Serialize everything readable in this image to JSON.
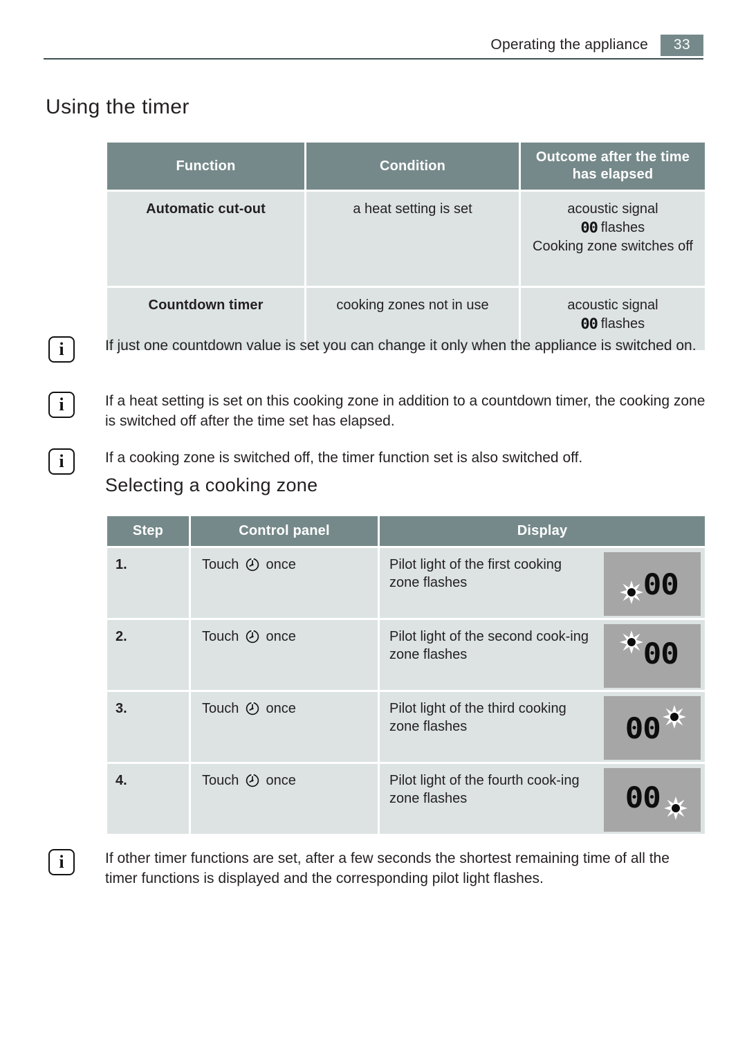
{
  "header": {
    "running_title": "Operating the appliance",
    "page_number": "33"
  },
  "headings": {
    "using_the_timer": "Using the timer",
    "selecting_a_cooking_zone": "Selecting a cooking zone"
  },
  "timer_table": {
    "columns": [
      "Function",
      "Condition",
      "Outcome after the time has elapsed"
    ],
    "rows": [
      {
        "function": "Automatic cut-out",
        "condition": "a heat setting is set",
        "outcome_line1": "acoustic signal",
        "outcome_segment": "00",
        "outcome_line2": "flashes",
        "outcome_line3": "Cooking zone switches off"
      },
      {
        "function": "Countdown timer",
        "condition": "cooking zones not in use",
        "outcome_line1": "acoustic signal",
        "outcome_segment": "00",
        "outcome_line2": "flashes",
        "outcome_line3": ""
      }
    ]
  },
  "notes": [
    {
      "icon": "info-icon",
      "text": "If just one countdown value is set you can change it only when the appliance is switched on."
    },
    {
      "icon": "info-icon",
      "text": "If a heat setting is set on this cooking zone in addition to a countdown timer, the cooking zone is switched off after the time set has elapsed."
    },
    {
      "icon": "info-icon",
      "text": "If a cooking zone is switched off, the timer function set is also switched off."
    },
    {
      "icon": "info-icon",
      "text": "If other timer functions are set, after a few seconds the shortest remaining time of all the timer functions is displayed and the corresponding pilot light flashes."
    }
  ],
  "select_zone_table": {
    "columns": [
      "Step",
      "Control panel",
      "Display"
    ],
    "rows": [
      {
        "step": "1.",
        "control_prefix": "Touch",
        "control_icon": "timer-clock-icon",
        "control_suffix": "once",
        "display_text": "Pilot light of the first cooking zone flashes",
        "lcd_value": "00",
        "lcd_dot_position": "bottom-left"
      },
      {
        "step": "2.",
        "control_prefix": "Touch",
        "control_icon": "timer-clock-icon",
        "control_suffix": "once",
        "display_text": "Pilot light of the second cook-ing zone flashes",
        "lcd_value": "00",
        "lcd_dot_position": "top-left"
      },
      {
        "step": "3.",
        "control_prefix": "Touch",
        "control_icon": "timer-clock-icon",
        "control_suffix": "once",
        "display_text": "Pilot light of the third cooking zone flashes",
        "lcd_value": "00",
        "lcd_dot_position": "top-right"
      },
      {
        "step": "4.",
        "control_prefix": "Touch",
        "control_icon": "timer-clock-icon",
        "control_suffix": "once",
        "display_text": "Pilot light of the fourth cook-ing zone flashes",
        "lcd_value": "00",
        "lcd_dot_position": "bottom-right"
      }
    ]
  },
  "colors": {
    "table_header_bg": "#76898a",
    "table_cell_bg": "#dde3e3",
    "lcd_panel_bg": "#a6a6a6",
    "rule": "#3d4f50",
    "text": "#231f20"
  },
  "info_icon_glyph": "i"
}
